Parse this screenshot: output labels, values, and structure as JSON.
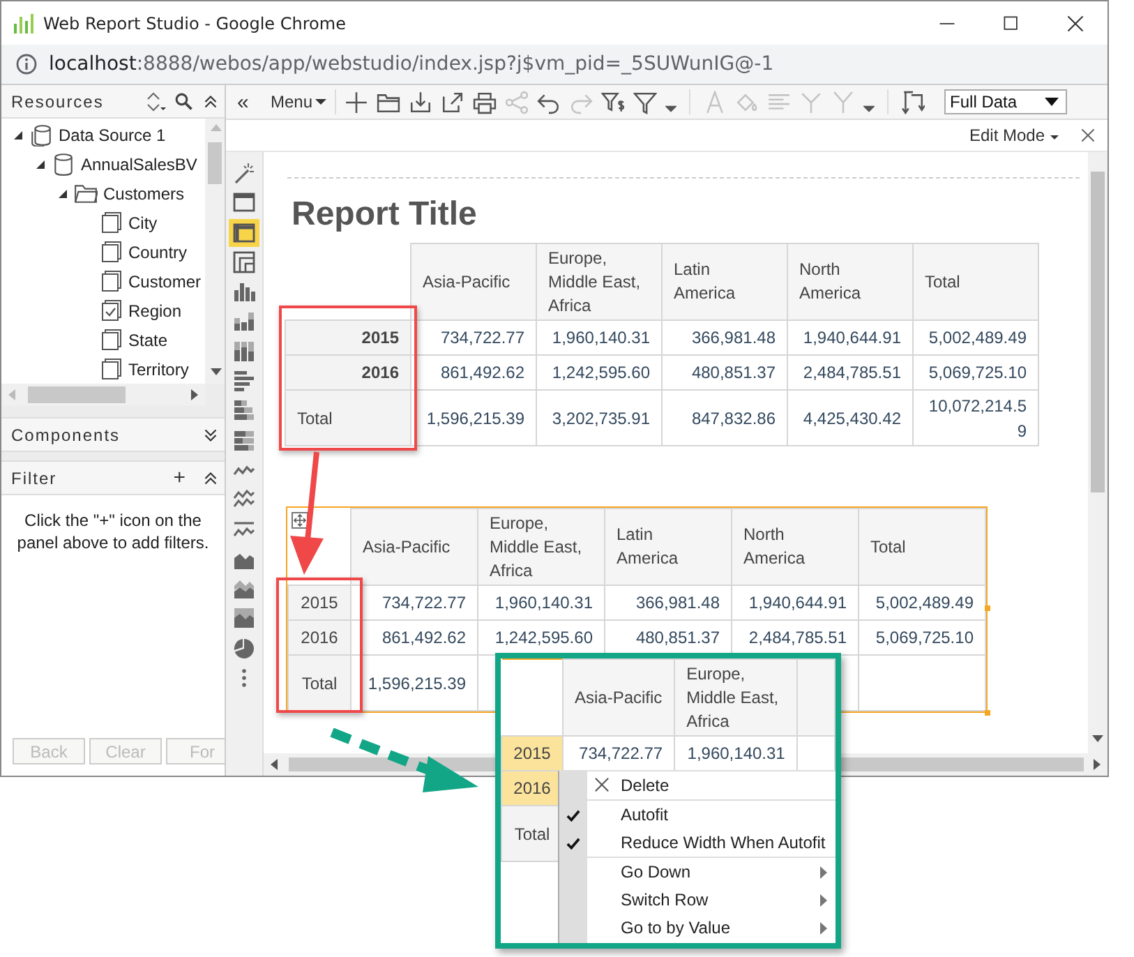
{
  "window": {
    "title": "Web Report Studio - Google Chrome",
    "url_host": "localhost",
    "url_rest": ":8888/webos/app/webstudio/index.jsp?j$vm_pid=_5SUWunIG@-1"
  },
  "resources": {
    "title": "Resources",
    "tree": [
      {
        "label": "Data Source 1",
        "kind": "datasource",
        "expanded": true,
        "children": [
          {
            "label": "AnnualSalesBV",
            "kind": "database",
            "expanded": true,
            "children": [
              {
                "label": "Customers",
                "kind": "folder",
                "expanded": true,
                "children": [
                  {
                    "label": "City",
                    "kind": "field",
                    "checked": false
                  },
                  {
                    "label": "Country",
                    "kind": "field",
                    "checked": false
                  },
                  {
                    "label": "Customer",
                    "kind": "field",
                    "checked": false
                  },
                  {
                    "label": "Region",
                    "kind": "field",
                    "checked": true
                  },
                  {
                    "label": "State",
                    "kind": "field",
                    "checked": false
                  },
                  {
                    "label": "Territory",
                    "kind": "field",
                    "checked": false
                  }
                ]
              }
            ]
          }
        ]
      }
    ]
  },
  "components": {
    "title": "Components"
  },
  "filter": {
    "title": "Filter",
    "add": "+",
    "message": "Click the \"+\" icon on the panel above to add filters."
  },
  "nav_buttons": [
    {
      "label": "Back",
      "disabled": true
    },
    {
      "label": "Clear",
      "disabled": true
    },
    {
      "label": "For",
      "disabled": true
    }
  ],
  "toolbar": {
    "collapse": "«",
    "menu": "Menu",
    "tools": [
      {
        "kind": "add",
        "disabled": false
      },
      {
        "kind": "open",
        "disabled": false
      },
      {
        "kind": "save",
        "disabled": false
      },
      {
        "kind": "export",
        "disabled": false
      },
      {
        "kind": "print",
        "disabled": false
      },
      {
        "kind": "share",
        "disabled": true
      },
      {
        "kind": "undo",
        "disabled": false
      },
      {
        "kind": "redo",
        "disabled": true
      },
      {
        "kind": "filter-value",
        "disabled": false
      },
      {
        "kind": "filter",
        "disabled": false
      },
      {
        "kind": "caret",
        "disabled": false
      },
      {
        "kind": "separator"
      },
      {
        "kind": "font",
        "disabled": true
      },
      {
        "kind": "fill",
        "disabled": true
      },
      {
        "kind": "align",
        "disabled": true
      },
      {
        "kind": "merge",
        "disabled": true
      },
      {
        "kind": "branch",
        "disabled": true
      },
      {
        "kind": "caret",
        "disabled": false
      },
      {
        "kind": "separator"
      },
      {
        "kind": "swap",
        "disabled": false
      }
    ],
    "view": "Full Data"
  },
  "mode": {
    "label": "Edit Mode"
  },
  "component_bar": [
    {
      "kind": "wand",
      "selected": false
    },
    {
      "kind": "text-box",
      "selected": false
    },
    {
      "kind": "table",
      "selected": true
    },
    {
      "kind": "crosstab",
      "selected": false
    },
    {
      "kind": "column",
      "selected": false
    },
    {
      "kind": "stacked-column",
      "selected": false
    },
    {
      "kind": "column-100",
      "selected": false
    },
    {
      "kind": "bar",
      "selected": false
    },
    {
      "kind": "stacked-bar",
      "selected": false
    },
    {
      "kind": "bar-100",
      "selected": false
    },
    {
      "kind": "line",
      "selected": false
    },
    {
      "kind": "multi-line",
      "selected": false
    },
    {
      "kind": "target-line",
      "selected": false
    },
    {
      "kind": "area",
      "selected": false
    },
    {
      "kind": "stacked-area",
      "selected": false
    },
    {
      "kind": "area-100",
      "selected": false
    },
    {
      "kind": "pie",
      "selected": false
    },
    {
      "kind": "more",
      "selected": false
    }
  ],
  "report": {
    "title": "Report Title",
    "tables": [
      {
        "selected": false,
        "columns": [
          "Asia-Pacific",
          "Europe, Middle East, Africa",
          "Latin America",
          "North America",
          "Total"
        ],
        "rows": [
          {
            "header": "2015",
            "cells": [
              "734,722.77",
              "1,960,140.31",
              "366,981.48",
              "1,940,644.91",
              "5,002,489.49"
            ]
          },
          {
            "header": "2016",
            "cells": [
              "861,492.62",
              "1,242,595.60",
              "480,851.37",
              "2,484,785.51",
              "5,069,725.10"
            ]
          },
          {
            "header": "Total",
            "cells": [
              "1,596,215.39",
              "3,202,735.91",
              "847,832.86",
              "4,425,430.42",
              "10,072,214.59"
            ]
          }
        ]
      },
      {
        "selected": true,
        "columns": [
          "Asia-Pacific",
          "Europe, Middle East, Africa",
          "Latin America",
          "North America",
          "Total"
        ],
        "rows": [
          {
            "header": "2015",
            "cells": [
              "734,722.77",
              "1,960,140.31",
              "366,981.48",
              "1,940,644.91",
              "5,002,489.49"
            ]
          },
          {
            "header": "2016",
            "cells": [
              "861,492.62",
              "1,242,595.60",
              "480,851.37",
              "2,484,785.51",
              "5,069,725.10"
            ]
          },
          {
            "header": "Total",
            "cells": [
              "1,596,215.39"
            ]
          }
        ]
      }
    ]
  },
  "callout": {
    "columns": [
      "Asia-Pacific",
      "Europe, Middle East, Africa"
    ],
    "rows": [
      {
        "header": "2015",
        "selected": true,
        "cells": [
          "734,722.77",
          "1,960,140.31"
        ]
      },
      {
        "header": "2016",
        "selected": true,
        "cells": []
      },
      {
        "header": "Total",
        "selected": false,
        "cells": []
      }
    ],
    "menu": [
      {
        "label": "Delete",
        "kind": "delete",
        "checked": false
      },
      {
        "label": "Autofit",
        "kind": "toggle",
        "checked": true
      },
      {
        "label": "Reduce Width When Autofit",
        "kind": "toggle",
        "checked": true
      },
      {
        "label": "Go Down",
        "kind": "submenu",
        "checked": false
      },
      {
        "label": "Switch Row",
        "kind": "submenu",
        "checked": false
      },
      {
        "label": "Go to by Value",
        "kind": "submenu",
        "checked": false
      }
    ]
  }
}
